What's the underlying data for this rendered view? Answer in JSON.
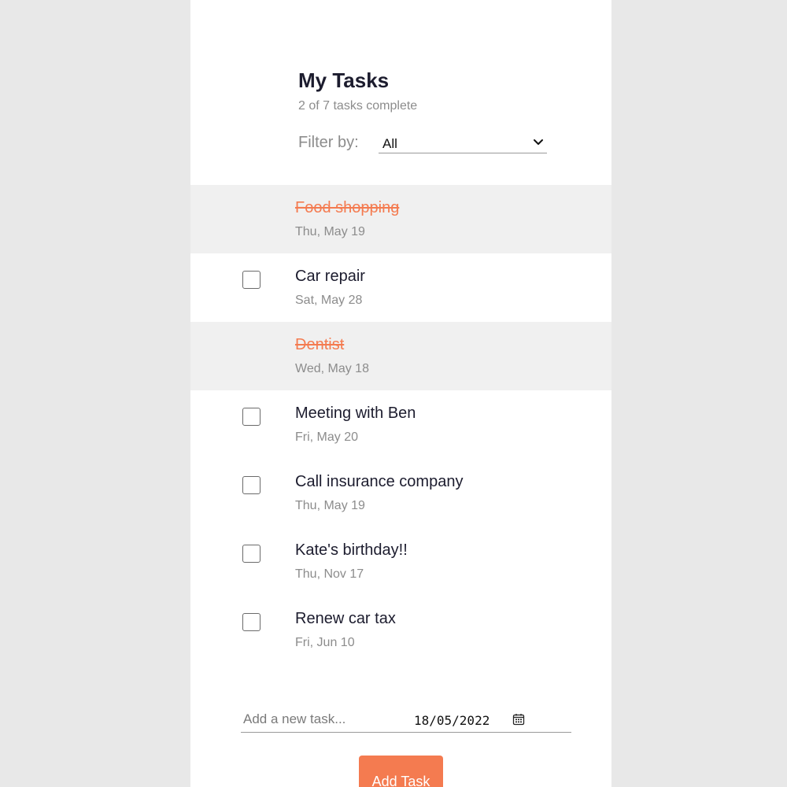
{
  "header": {
    "title": "My Tasks",
    "subtitle": "2 of 7 tasks complete"
  },
  "filter": {
    "label": "Filter by:",
    "selected": "All",
    "icon": "chevron-down-icon"
  },
  "tasks": [
    {
      "name": "Food shopping",
      "date": "Thu, May 19",
      "done": true
    },
    {
      "name": "Car repair",
      "date": "Sat, May 28",
      "done": false
    },
    {
      "name": "Dentist",
      "date": "Wed, May 18",
      "done": true
    },
    {
      "name": "Meeting with Ben",
      "date": "Fri, May 20",
      "done": false
    },
    {
      "name": "Call insurance company",
      "date": "Thu, May 19",
      "done": false
    },
    {
      "name": "Kate's birthday!!",
      "date": "Thu, Nov 17",
      "done": false
    },
    {
      "name": "Renew car tax",
      "date": "Fri, Jun 10",
      "done": false
    }
  ],
  "new_task": {
    "placeholder": "Add a new task...",
    "value": "",
    "date": "18/05/2022",
    "date_icon": "calendar-icon",
    "button_label": "Add Task"
  },
  "colors": {
    "accent": "#f47b50",
    "background": "#e8e8e8",
    "panel": "#ffffff",
    "done_row": "#f0f0f0",
    "muted_text": "#8c8c8c"
  }
}
